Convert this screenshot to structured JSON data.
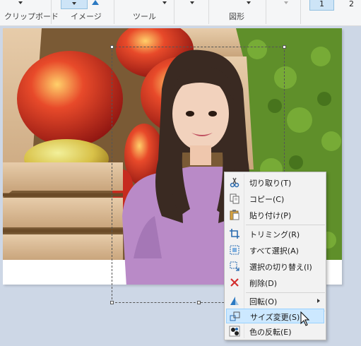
{
  "ribbon": {
    "groups": [
      {
        "label": "クリップボード"
      },
      {
        "label": "イメージ"
      },
      {
        "label": "ツール"
      },
      {
        "label": "図形"
      }
    ],
    "page_active": "1",
    "page_next": "2"
  },
  "context_menu": {
    "items": [
      {
        "label": "切り取り(T)",
        "icon": "scissors-icon"
      },
      {
        "label": "コピー(C)",
        "icon": "copy-icon"
      },
      {
        "label": "貼り付け(P)",
        "icon": "paste-icon"
      },
      {
        "label": "トリミング(R)",
        "icon": "crop-icon"
      },
      {
        "label": "すべて選択(A)",
        "icon": "select-all-icon"
      },
      {
        "label": "選択の切り替え(I)",
        "icon": "invert-selection-icon"
      },
      {
        "label": "削除(D)",
        "icon": "delete-icon"
      },
      {
        "label": "回転(O)",
        "icon": "rotate-icon",
        "has_submenu": true
      },
      {
        "label": "サイズ変更(S)",
        "icon": "resize-icon",
        "highlighted": true
      },
      {
        "label": "色の反転(E)",
        "icon": "invert-color-icon"
      }
    ]
  },
  "colors": {
    "accent": "#cce8ff",
    "workspace": "#cdd7e6",
    "ribbon": "#f5f6f7"
  }
}
